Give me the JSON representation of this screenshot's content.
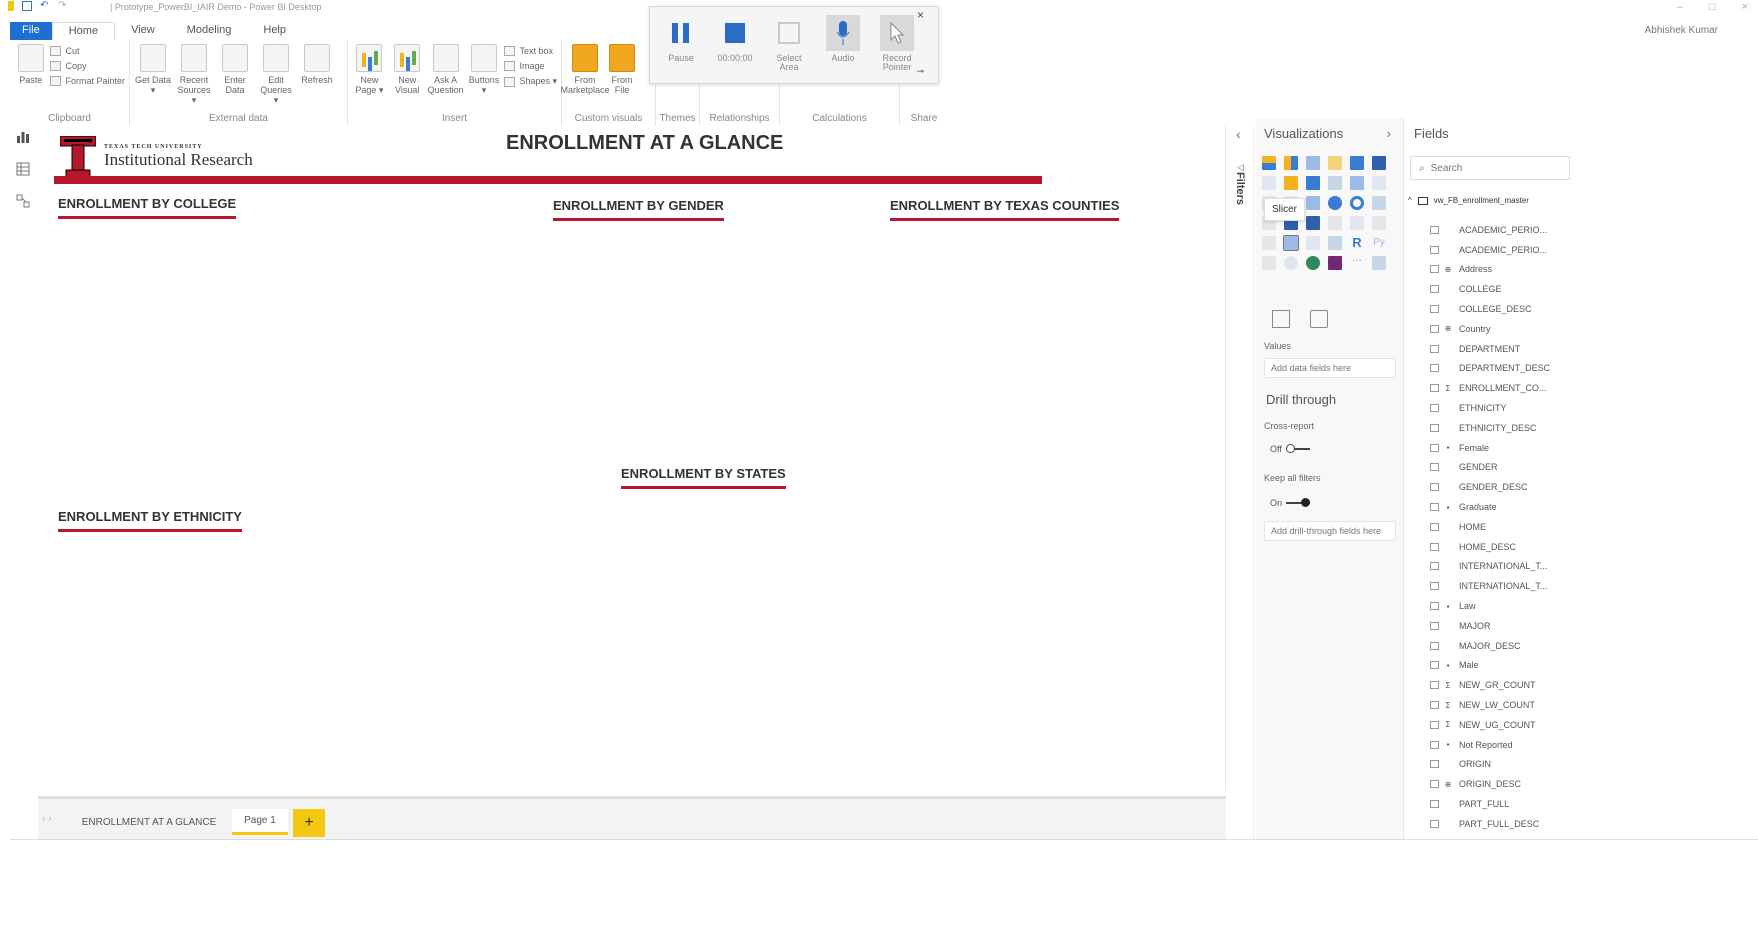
{
  "window": {
    "title": "| Prototype_PowerBI_IAIR Demo - Power BI Desktop",
    "user": "Abhishek Kumar"
  },
  "ribbon_tabs": [
    "File",
    "Home",
    "View",
    "Modeling",
    "Help"
  ],
  "ribbon": {
    "clipboard": {
      "paste": "Paste",
      "cut": "Cut",
      "copy": "Copy",
      "format_painter": "Format Painter",
      "label": "Clipboard"
    },
    "external": {
      "get_data": "Get Data ▾",
      "recent_sources": "Recent Sources ▾",
      "enter_data": "Enter Data",
      "edit_queries": "Edit Queries ▾",
      "refresh": "Refresh",
      "label": "External data"
    },
    "insert": {
      "new_page": "New Page ▾",
      "new_visual": "New Visual",
      "ask_question": "Ask A Question",
      "buttons": "Buttons ▾",
      "text_box": "Text box",
      "image": "Image",
      "shapes": "Shapes ▾",
      "label": "Insert"
    },
    "custom": {
      "from_marketplace": "From Marketplace",
      "from_file": "From File",
      "label": "Custom visuals"
    },
    "themes_label": "Themes",
    "relationships_label": "Relationships",
    "calculations_label": "Calculations",
    "share_label": "Share"
  },
  "recorder": {
    "pause": "Pause",
    "time": "00:00:00",
    "select_area": "Select Area",
    "audio": "Audio",
    "record_pointer": "Record Pointer",
    "close": "×"
  },
  "canvas": {
    "logo_university": "TEXAS TECH UNIVERSITY",
    "logo_department": "Institutional Research",
    "title": "ENROLLMENT AT A GLANCE",
    "sections": {
      "college": "ENROLLMENT BY COLLEGE",
      "gender": "ENROLLMENT BY GENDER",
      "counties": "ENROLLMENT BY TEXAS COUNTIES",
      "states": "ENROLLMENT BY STATES",
      "ethnicity": "ENROLLMENT BY ETHNICITY"
    }
  },
  "page_tabs": [
    "ENROLLMENT AT A GLANCE",
    "Page 1"
  ],
  "filters_label": "Filters",
  "visualizations": {
    "title": "Visualizations",
    "tooltip": "Slicer",
    "values_label": "Values",
    "values_placeholder": "Add data fields here",
    "drill_title": "Drill through",
    "cross_report": "Cross-report",
    "cross_report_state": "Off",
    "keep_filters": "Keep all filters",
    "keep_filters_state": "On",
    "drill_placeholder": "Add drill-through fields here"
  },
  "fields": {
    "title": "Fields",
    "search_placeholder": "Search",
    "table_name": "vw_FB_enrollment_master",
    "items": [
      {
        "name": "ACADEMIC_PERIO...",
        "type": ""
      },
      {
        "name": "ACADEMIC_PERIO...",
        "type": ""
      },
      {
        "name": "Address",
        "type": "globe"
      },
      {
        "name": "COLLEGE",
        "type": ""
      },
      {
        "name": "COLLEGE_DESC",
        "type": ""
      },
      {
        "name": "Country",
        "type": "globe"
      },
      {
        "name": "DEPARTMENT",
        "type": ""
      },
      {
        "name": "DEPARTMENT_DESC",
        "type": ""
      },
      {
        "name": "ENROLLMENT_CO...",
        "type": "sum"
      },
      {
        "name": "ETHNICITY",
        "type": ""
      },
      {
        "name": "ETHNICITY_DESC",
        "type": ""
      },
      {
        "name": "Female",
        "type": "measure"
      },
      {
        "name": "GENDER",
        "type": ""
      },
      {
        "name": "GENDER_DESC",
        "type": ""
      },
      {
        "name": "Graduate",
        "type": "measure"
      },
      {
        "name": "HOME",
        "type": ""
      },
      {
        "name": "HOME_DESC",
        "type": ""
      },
      {
        "name": "INTERNATIONAL_T...",
        "type": ""
      },
      {
        "name": "INTERNATIONAL_T...",
        "type": ""
      },
      {
        "name": "Law",
        "type": "measure"
      },
      {
        "name": "MAJOR",
        "type": ""
      },
      {
        "name": "MAJOR_DESC",
        "type": ""
      },
      {
        "name": "Male",
        "type": "measure"
      },
      {
        "name": "NEW_GR_COUNT",
        "type": "sum"
      },
      {
        "name": "NEW_LW_COUNT",
        "type": "sum"
      },
      {
        "name": "NEW_UG_COUNT",
        "type": "sum"
      },
      {
        "name": "Not Reported",
        "type": "measure"
      },
      {
        "name": "ORIGIN",
        "type": ""
      },
      {
        "name": "ORIGIN_DESC",
        "type": "globe"
      },
      {
        "name": "PART_FULL",
        "type": ""
      },
      {
        "name": "PART_FULL_DESC",
        "type": ""
      }
    ]
  },
  "colors": {
    "accent_red": "#b5172b",
    "file_blue": "#1e6fcf",
    "tab_yellow": "#f2c811"
  }
}
